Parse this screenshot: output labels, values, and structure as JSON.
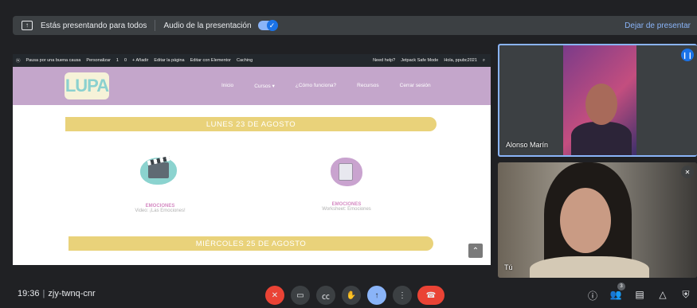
{
  "presenting_bar": {
    "presenting_text": "Estás presentando para todos",
    "audio_label": "Audio de la presentación",
    "audio_enabled": true,
    "stop_label": "Dejar de presentar"
  },
  "shared_screen": {
    "wp_admin_bar": {
      "left_items": [
        "Pausa por una buena causa",
        "Personalizar",
        "1",
        "0",
        "+ Añadir",
        "Editar la página",
        "Editar con Elementor",
        "Caching"
      ],
      "right_items": [
        "Need help?",
        "Jetpack Safe Mode",
        "Hola, ppubc2021"
      ]
    },
    "site": {
      "logo_text": "LUPA",
      "nav": [
        "Inicio",
        "Cursos ▾",
        "¿Cómo funciona?",
        "Recursos",
        "Cerrar sesión"
      ],
      "day1": "LUNES 23 DE AGOSTO",
      "day2": "MIÉRCOLES 25 DE AGOSTO",
      "tiles": [
        {
          "title": "EMOCIONES",
          "subtitle": "Video: ¡Las Emociones!"
        },
        {
          "title": "EMOCIONES",
          "subtitle": "Worksheet: Emociones"
        }
      ]
    }
  },
  "participants": [
    {
      "name": "Alonso Marín",
      "speaking": true
    },
    {
      "name": "Tú",
      "muted": true
    }
  ],
  "bottom_bar": {
    "time": "19:36",
    "meeting_code": "zjy-twnq-cnr",
    "participant_count": "3"
  },
  "colors": {
    "background": "#202124",
    "accent": "#8ab4f8",
    "hangup": "#ea4335",
    "header_purple": "#c4a6cb",
    "day_yellow": "#e9d27a"
  }
}
